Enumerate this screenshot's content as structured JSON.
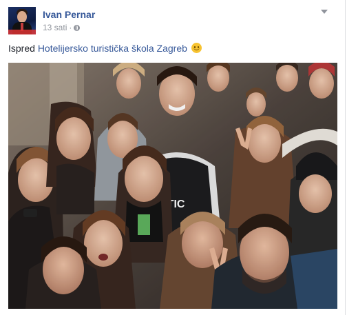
{
  "post": {
    "author": "Ivan Pernar",
    "time": "13 sati",
    "separator": "·",
    "privacy_icon": "globe-icon",
    "menu_icon": "chevron-down-icon",
    "text_prefix": "Ispred ",
    "text_link": "Hotelijersko turistička škola Zagreb",
    "emoji_icon": "smiley-icon",
    "photo_caption_text": "ETIC"
  },
  "colors": {
    "link": "#365899",
    "meta": "#90949c",
    "text": "#1d2129"
  }
}
